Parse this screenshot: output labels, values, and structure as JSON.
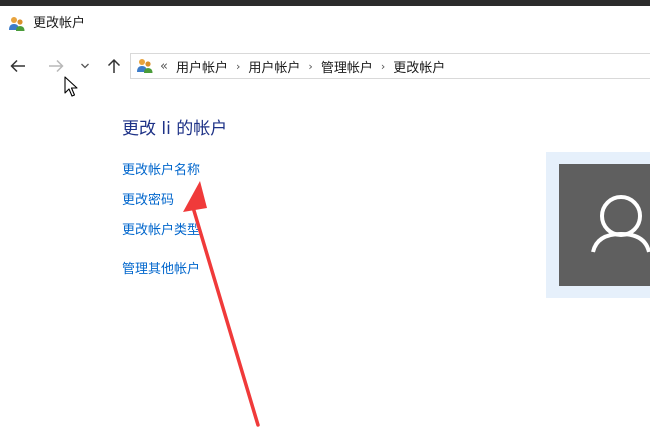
{
  "window": {
    "title": "更改帐户",
    "app_icon": "users-icon"
  },
  "navigation": {
    "back_icon": "back-arrow-icon",
    "forward_icon": "forward-arrow-icon",
    "recent_icon": "chevron-down-icon",
    "up_icon": "up-arrow-icon"
  },
  "address_bar": {
    "icon": "users-icon",
    "overflow": "«",
    "breadcrumbs": [
      "用户帐户",
      "用户帐户",
      "管理帐户",
      "更改帐户"
    ],
    "separator": "›",
    "dropdown": "⌄"
  },
  "main": {
    "heading": "更改 li 的帐户",
    "links": {
      "rename": "更改帐户名称",
      "password": "更改密码",
      "type": "更改帐户类型",
      "manage": "管理其他帐户"
    }
  },
  "account_picture": {
    "icon": "user-silhouette-icon"
  },
  "annotation": {
    "arrow_color": "#f03a3a",
    "arrow_target": "更改帐户名称"
  },
  "colors": {
    "heading": "#1e3287",
    "link": "#0066cc",
    "avatar_bg": "#5f5f5f",
    "avatar_frame": "#e6f0fb"
  }
}
